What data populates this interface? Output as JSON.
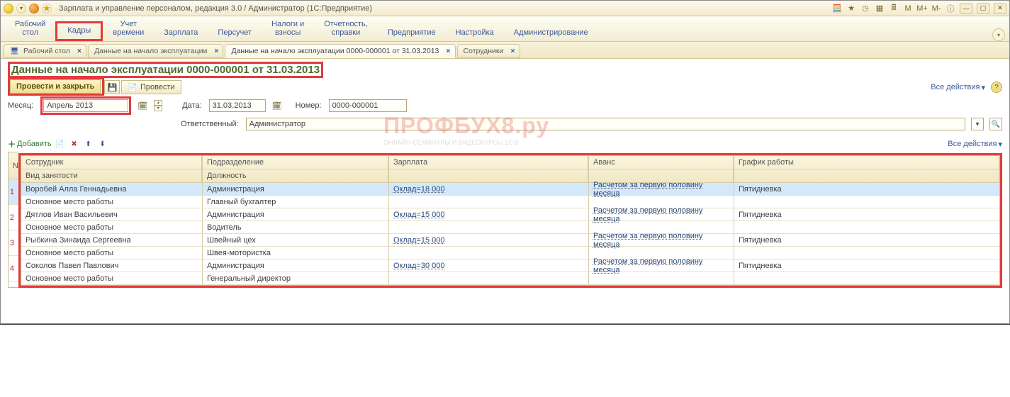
{
  "titlebar": {
    "app_title": "Зарплата и управление персоналом, редакция 3.0 / Администратор  (1С:Предприятие)",
    "right_labels": {
      "m": "M",
      "m_plus": "M+",
      "m_minus": "M-"
    }
  },
  "sections": {
    "items": [
      "Рабочий\nстол",
      "Кадры",
      "Учет\nвремени",
      "Зарплата",
      "Персучет",
      "Налоги и\nвзносы",
      "Отчетность,\nсправки",
      "Предприятие",
      "Настройка",
      "Администрирование"
    ],
    "highlighted_index": 1
  },
  "tabs": [
    {
      "label": "Рабочий стол",
      "active": false,
      "icon": "desktop"
    },
    {
      "label": "Данные на начало эксплуатации",
      "active": false
    },
    {
      "label": "Данные на начало эксплуатации 0000-000001 от 31.03.2013",
      "active": true
    },
    {
      "label": "Сотрудники",
      "active": false
    }
  ],
  "form": {
    "title": "Данные на начало эксплуатации 0000-000001 от 31.03.2013",
    "cmd_primary": "Провести и закрыть",
    "cmd_post": "Провести",
    "all_actions": "Все действия",
    "month_label": "Месяц:",
    "month_value": "Апрель 2013",
    "date_label": "Дата:",
    "date_value": "31.03.2013",
    "number_label": "Номер:",
    "number_value": "0000-000001",
    "responsible_label": "Ответственный:",
    "responsible_value": "Администратор",
    "add_label": "Добавить"
  },
  "table": {
    "headers": {
      "n": "N",
      "employee": "Сотрудник",
      "emp_sub": "Вид занятости",
      "dept": "Подразделение",
      "dept_sub": "Должность",
      "salary": "Зарплата",
      "advance": "Аванс",
      "schedule": "График работы"
    },
    "rows": [
      {
        "n": "1",
        "employee": "Воробей Алла Геннадьевна",
        "emptype": "Основное место работы",
        "dept": "Администрация",
        "post": "Главный бухгалтер",
        "salary": "Оклад=18 000",
        "advance": "Расчетом за первую половину месяца",
        "schedule": "Пятидневка",
        "selected": true
      },
      {
        "n": "2",
        "employee": "Дятлов Иван Васильевич",
        "emptype": "Основное место работы",
        "dept": "Администрация",
        "post": "Водитель",
        "salary": "Оклад=15 000",
        "advance": "Расчетом за первую половину месяца",
        "schedule": "Пятидневка"
      },
      {
        "n": "3",
        "employee": "Рыбкина Зинаида Сергеевна",
        "emptype": "Основное место работы",
        "dept": "Швейный цех",
        "post": "Швея-мотористка",
        "salary": "Оклад=15 000",
        "advance": "Расчетом за первую половину месяца",
        "schedule": "Пятидневка"
      },
      {
        "n": "4",
        "employee": "Соколов Павел Павлович",
        "emptype": "Основное место работы",
        "dept": "Администрация",
        "post": "Генеральный директор",
        "salary": "Оклад=30 000",
        "advance": "Расчетом за первую половину месяца",
        "schedule": "Пятидневка"
      }
    ]
  },
  "watermark": {
    "line1": "ПРОФБУХ8.ру",
    "line2": "ОНЛАЙН-СЕМИНАРЫ И ВИДЕОКУРСЫ 1С:8"
  }
}
